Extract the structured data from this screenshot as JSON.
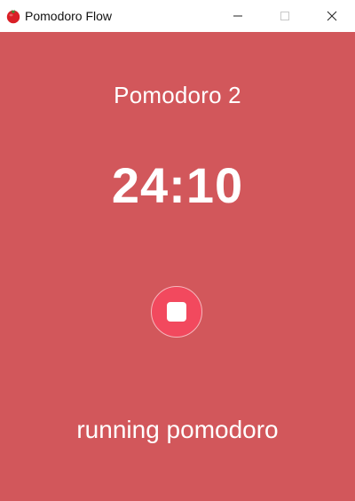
{
  "window": {
    "title": "Pomodoro Flow",
    "app_icon": "tomato-icon",
    "controls": [
      "minimize-icon",
      "maximize-icon",
      "close-icon"
    ],
    "background_color": "#d2575b"
  },
  "main": {
    "session_title": "Pomodoro 2",
    "timer": "24:10",
    "stop_button_icon": "stop-icon",
    "stop_button_color": "#f2495e",
    "status": "running pomodoro"
  }
}
